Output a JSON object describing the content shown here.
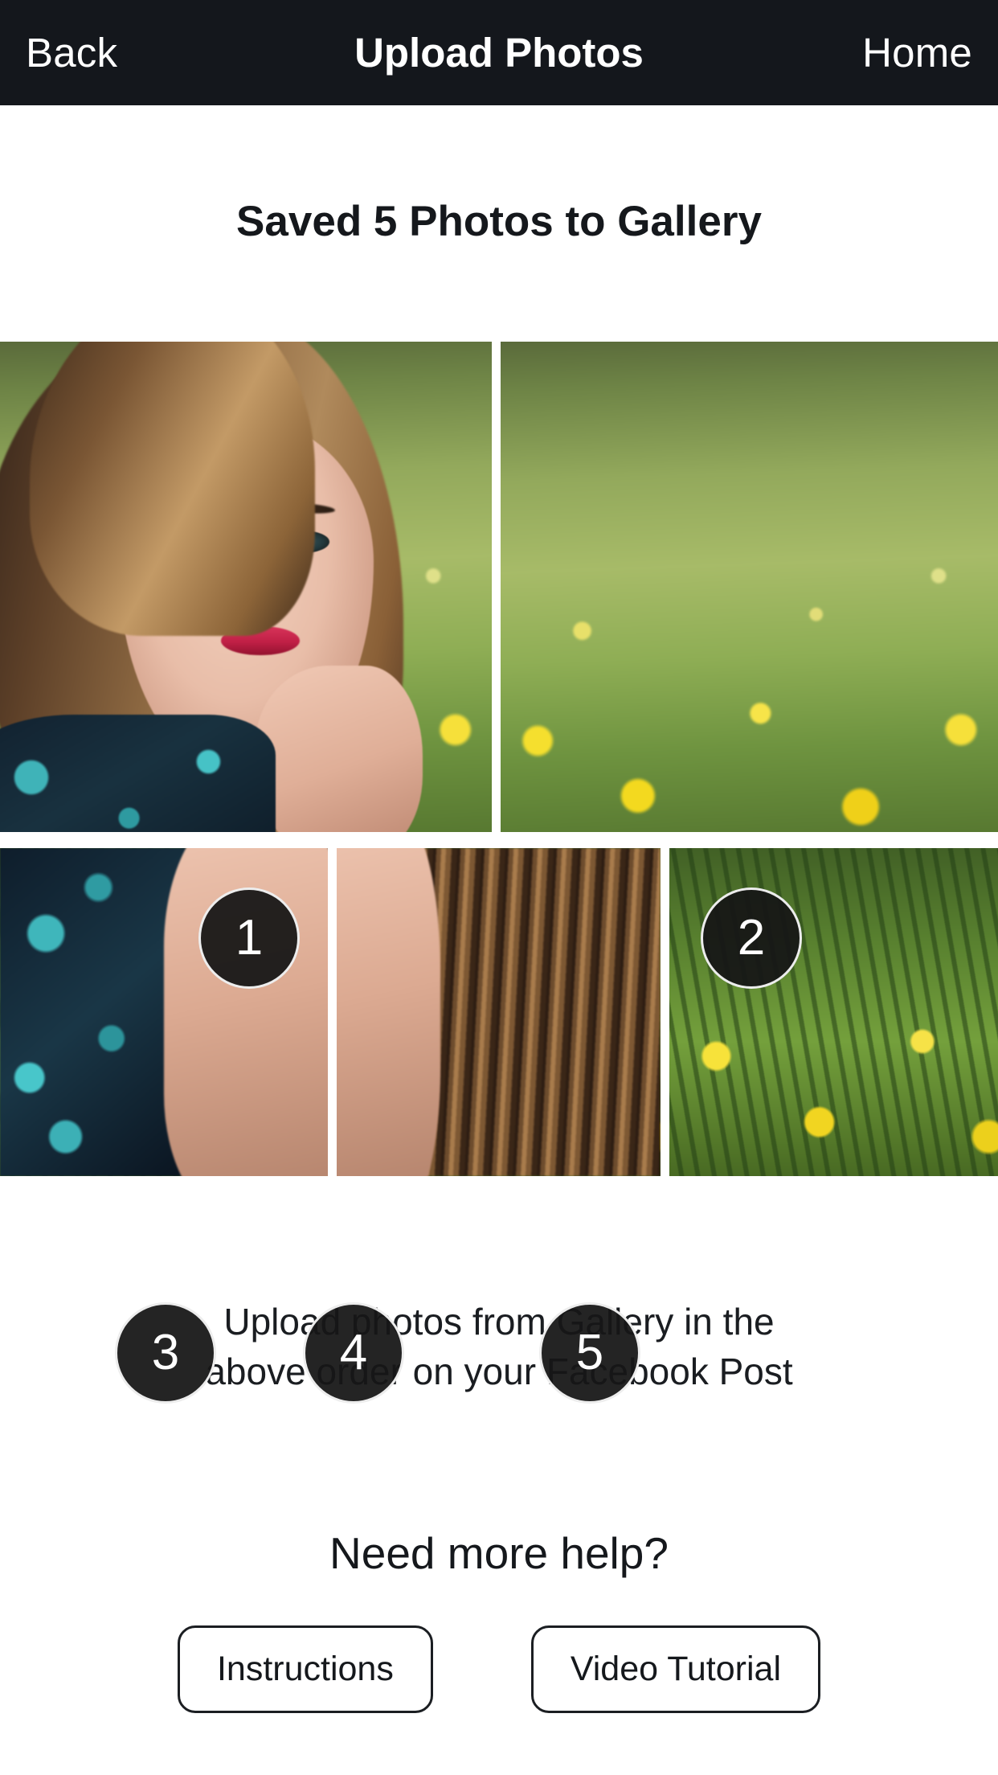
{
  "navbar": {
    "back_label": "Back",
    "title": "Upload Photos",
    "home_label": "Home",
    "background_color": "#14171c",
    "text_color": "#ffffff"
  },
  "main": {
    "saved_heading": "Saved 5 Photos to Gallery",
    "photo_count": 5,
    "instruction_line_1": "Upload photos from Gallery in the",
    "instruction_line_2": "above order on your Facebook Post",
    "photos": [
      {
        "order": "1",
        "alt": "woman portrait face close up in meadow"
      },
      {
        "order": "2",
        "alt": "blurred green meadow with yellow dandelions"
      },
      {
        "order": "3",
        "alt": "teal floral patterned shirt shoulder"
      },
      {
        "order": "4",
        "alt": "long brown hair over shoulder"
      },
      {
        "order": "5",
        "alt": "green grass with yellow dandelion flowers"
      }
    ],
    "badge_background": "#161616",
    "badge_border_color": "#ffffff",
    "badge_text_color": "#ffffff"
  },
  "help": {
    "title": "Need more help?",
    "buttons": [
      {
        "label": "Instructions"
      },
      {
        "label": "Video Tutorial"
      }
    ],
    "button_border_color": "#1b1e22"
  }
}
